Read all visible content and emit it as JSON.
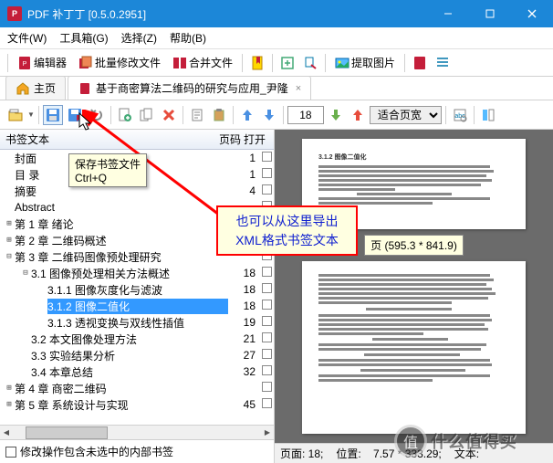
{
  "window": {
    "title": "PDF 补丁丁 [0.5.0.2951]"
  },
  "menu": {
    "file": "文件(W)",
    "toolbox": "工具箱(G)",
    "select": "选择(Z)",
    "help": "帮助(B)"
  },
  "toolbar": {
    "editor": "编辑器",
    "batch_modify": "批量修改文件",
    "merge_files": "合并文件",
    "extract_images": "提取图片"
  },
  "tabs": {
    "home": "主页",
    "doc": "基于商密算法二维码的研究与应用_尹隆"
  },
  "toolbar2": {
    "page_value": "18",
    "zoom_mode": "适合页宽"
  },
  "bookmark": {
    "col_title": "书签文本",
    "col_page": "页码",
    "col_open": "打开",
    "footer_checkbox": "修改操作包含未选中的内部书签"
  },
  "tree": [
    {
      "indent": 0,
      "exp": "",
      "label": "封面",
      "page": "1"
    },
    {
      "indent": 0,
      "exp": "",
      "label": "目  录",
      "page": "1"
    },
    {
      "indent": 0,
      "exp": "",
      "label": "摘要",
      "page": "4"
    },
    {
      "indent": 0,
      "exp": "",
      "label": "Abstract",
      "page": ""
    },
    {
      "indent": 0,
      "exp": "⊞",
      "label": "第 1 章 绪论",
      "page": ""
    },
    {
      "indent": 0,
      "exp": "⊞",
      "label": "第 2 章 二维码概述",
      "page": ""
    },
    {
      "indent": 0,
      "exp": "⊟",
      "label": "第 3 章 二维码图像预处理研究",
      "page": ""
    },
    {
      "indent": 1,
      "exp": "⊟",
      "label": "3.1 图像预处理相关方法概述",
      "page": "18"
    },
    {
      "indent": 2,
      "exp": "",
      "label": "3.1.1 图像灰度化与滤波",
      "page": "18"
    },
    {
      "indent": 2,
      "exp": "",
      "label": "3.1.2 图像二值化",
      "page": "18",
      "selected": true
    },
    {
      "indent": 2,
      "exp": "",
      "label": "3.1.3 透视变换与双线性插值",
      "page": "19"
    },
    {
      "indent": 1,
      "exp": "",
      "label": "3.2 本文图像处理方法",
      "page": "21"
    },
    {
      "indent": 1,
      "exp": "",
      "label": "3.3 实验结果分析",
      "page": "27"
    },
    {
      "indent": 1,
      "exp": "",
      "label": "3.4 本章总结",
      "page": "32"
    },
    {
      "indent": 0,
      "exp": "⊞",
      "label": "第 4 章 商密二维码",
      "page": ""
    },
    {
      "indent": 0,
      "exp": "⊞",
      "label": "第 5 章 系统设计与实现",
      "page": "45"
    }
  ],
  "tooltip": {
    "line1": "保存书签文件",
    "line2": "Ctrl+Q"
  },
  "annotation": {
    "line1": "也可以从这里导出",
    "line2": "XML格式书签文本"
  },
  "status": {
    "page_dim_overlay": "页 (595.3 * 841.9)",
    "page": "页面: 18;",
    "pos": "位置:    7.57 * 333.29;",
    "text": "文本:  "
  },
  "preview_heading": "3.1.2 图像二值化",
  "watermark": "什么值得买"
}
